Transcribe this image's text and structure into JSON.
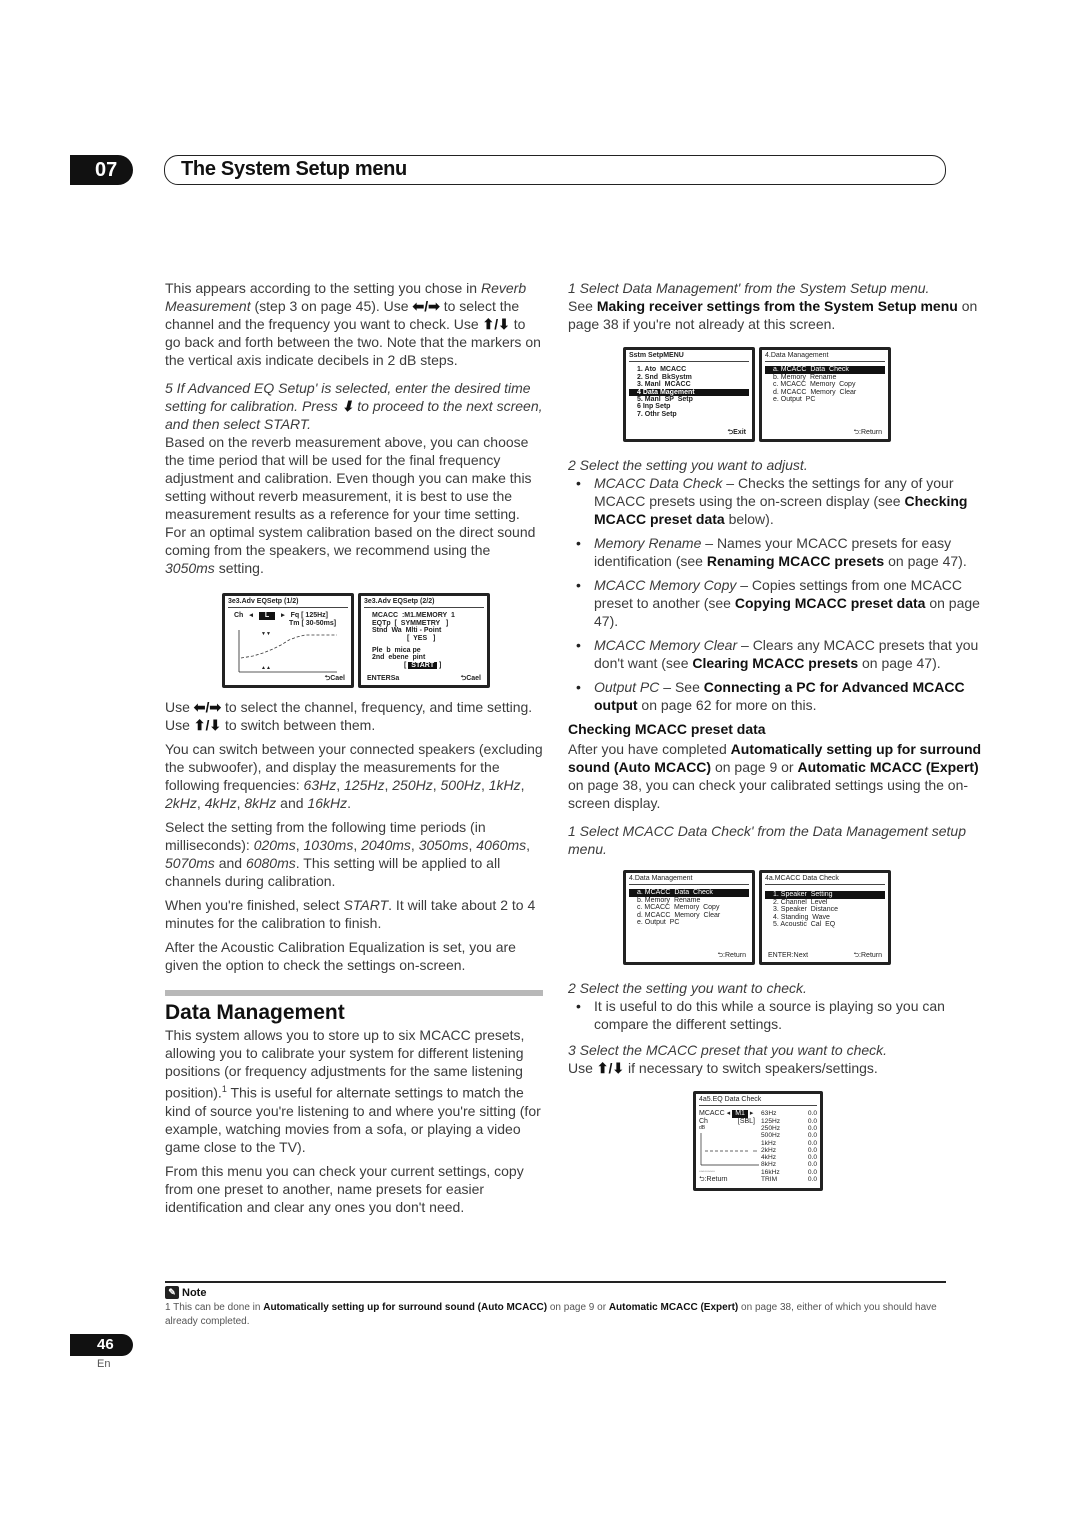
{
  "header": {
    "chapter": "07",
    "title": "The System Setup menu"
  },
  "left": {
    "p1": [
      "This appears according to the setting you chose in ",
      "Reverb Measurement",
      " (step 3 on page 45). Use ",
      "⬅/➡",
      " to select the channel and the frequency you want to check. Use ",
      "⬆/⬇",
      " to go back and forth between the two. Note that the markers on the vertical axis indicate decibels in 2 dB steps."
    ],
    "step5": [
      "5   If ",
      "Advanced EQ Setup",
      "' is selected, enter the desired time setting for calibration. Press ",
      "⬇",
      " to proceed to the next screen, and then select ",
      "START",
      "."
    ],
    "p2": [
      "Based on the reverb measurement above, you can choose the time period that will be used for the final frequency adjustment and calibration. Even though you can make this setting without reverb measurement, it is best to use the measurement results as a reference for your time setting. For an optimal system calibration based on the direct sound coming from the speakers, we recommend using the ",
      "3050ms",
      " setting."
    ],
    "osd1": {
      "title": "3e3.Adv EQSetp    (1/2)",
      "ch_label": "Ch",
      "ch_value": "L",
      "fq": "Fq [   125Hz]",
      "tm": "Tm [ 30-50ms]",
      "cancel": "⮌Cael"
    },
    "osd2": {
      "title": "3e3.Adv EQSetp    (2/2)",
      "rows": [
        "MCACC  :M1.MEMORY  1",
        "EQTp  [  SYMMETRY   ]",
        "Stnd  Wa  Mlti - Point",
        "                  [  YES   ]",
        "",
        "Ple  b  mica pe",
        "2nd  ebene  pint"
      ],
      "start": "START",
      "enter": "ENTERSa",
      "cancel": "⮌Cael"
    },
    "p3": [
      "Use ",
      "⬅/➡",
      " to select the channel, frequency, and time setting. Use ",
      "⬆/⬇",
      " to switch between them."
    ],
    "p4": [
      "You can switch between your connected speakers (excluding the subwoofer), and display the measurements for the following frequencies: ",
      "63Hz",
      ", ",
      "125Hz",
      ", ",
      "250Hz",
      ", ",
      "500Hz",
      ", ",
      "1kHz",
      ", ",
      "2kHz",
      ", ",
      "4kHz",
      ", ",
      "8kHz",
      " and ",
      "16kHz",
      "."
    ],
    "p5": [
      "Select the setting from the following time periods (in milliseconds): ",
      "020ms",
      ", ",
      "1030ms",
      ", ",
      "2040ms",
      ", ",
      "3050ms",
      ", ",
      "4060ms",
      ", ",
      "5070ms",
      " and ",
      "6080ms",
      ". This setting will be applied to all channels during calibration."
    ],
    "p6": [
      "When you're finished, select ",
      "START",
      ". It will take about 2 to 4 minutes for the calibration to finish."
    ],
    "p7": "After the Acoustic Calibration Equalization is set, you are given the option to check the settings on-screen.",
    "section_title": "Data Management",
    "p8": [
      "This system allows you to store up to six MCACC presets, allowing you to calibrate your system for different listening positions (or frequency adjustments for the same listening position).",
      "1",
      " This is useful for alternate settings to match the kind of source you're listening to and where you're sitting (for example, watching movies from a sofa, or playing a video game close to the TV)."
    ],
    "p9": "From this menu you can check your current settings, copy from one preset to another, name presets for easier identification and clear any ones you don't need."
  },
  "right": {
    "step1": [
      "1   Select ",
      "Data Management",
      "' from the System Setup menu."
    ],
    "p1": [
      "See ",
      "Making receiver settings from the System Setup menu",
      " on page 38 if you're not already at this screen."
    ],
    "osd_menu": {
      "title": "Sstm  SetpMENU",
      "items": [
        "1. Ato  MCACC",
        "2. Snd  BkSystm",
        "3. Manl  MCACC",
        "4 Data Magement",
        "5. Manl  SP  Setp",
        "6 Inp Setp",
        "7. Othr Setp"
      ],
      "selected": 3,
      "exit": "⮌Exit"
    },
    "osd_dm": {
      "title": "4.Data  Management",
      "items": [
        "a. MCACC  Data  Check",
        "b. Memory  Rename",
        "c. MCACC  Memory  Copy",
        "d. MCACC  Memory  Clear",
        "e. Output  PC"
      ],
      "selected": 0,
      "return": "⮌:Return"
    },
    "step2": "2   Select the setting you want to adjust.",
    "bullets": [
      {
        "term": "MCACC Data Check",
        "text": " – Checks the settings for any of your MCACC presets using the on-screen display (see ",
        "link": "Checking MCACC preset data",
        "after": " below)."
      },
      {
        "term": "Memory Rename",
        "text": " – Names your MCACC presets for easy identification (see ",
        "link": "Renaming MCACC presets",
        "after": " on page 47)."
      },
      {
        "term": "MCACC Memory Copy",
        "text": " – Copies settings from one MCACC preset to another (see ",
        "link": "Copying MCACC preset data",
        "after": " on page 47)."
      },
      {
        "term": "MCACC Memory Clear",
        "text": " – Clears any MCACC presets that you don't want (see ",
        "link": "Clearing MCACC presets",
        "after": " on page 47)."
      },
      {
        "term": "Output PC",
        "text": " – See ",
        "link": "Connecting a PC for Advanced MCACC output",
        "after": " on page 62 for more on this."
      }
    ],
    "sub_title": "Checking MCACC preset data",
    "p2": [
      "After you have completed ",
      "Automatically setting up for surround sound (Auto MCACC)",
      " on page 9 or ",
      "Automatic MCACC (Expert)",
      " on page 38, you can check your calibrated settings using the on-screen display."
    ],
    "step1b": [
      "1   Select ",
      "MCACC Data Check",
      "' from the Data Management setup menu."
    ],
    "osd_dm2": {
      "title": "4.Data  Management",
      "items": [
        "a. MCACC  Data  Check",
        "b. Memory  Rename",
        "c. MCACC  Memory  Copy",
        "d. MCACC  Memory  Clear",
        "e. Output  PC"
      ],
      "selected": 0,
      "return": "⮌:Return"
    },
    "osd_check": {
      "title": "4a.MCACC  Data  Check",
      "items": [
        "1. Speaker  Setting",
        "2. Channel  Level",
        "3. Speaker  Distance",
        "4. Standing  Wave",
        "5. Acoustic  Cal  EQ"
      ],
      "selected": 0,
      "next": "ENTER:Next",
      "return": "⮌:Return"
    },
    "step2b": "2   Select the setting you want to check.",
    "bullet2": "It is useful to do this while a source is playing so you can compare the different settings.",
    "step3": [
      "3   Select the ",
      "MCACC preset",
      " that you want to check."
    ],
    "p3": [
      "Use ",
      "⬆/⬇",
      " if necessary to switch speakers/settings."
    ],
    "osd_eq": {
      "title": "4a5.EQ  Data  Check",
      "mcacc_label": "MCACC",
      "mcacc_value": "M1",
      "ch_label": "Ch",
      "ch_value": "[SBL]",
      "db_label": "dB",
      "rows": [
        [
          "63Hz",
          "0.0"
        ],
        [
          "125Hz",
          "0.0"
        ],
        [
          "250Hz",
          "0.0"
        ],
        [
          "500Hz",
          "0.0"
        ],
        [
          "1kHz",
          "0.0"
        ],
        [
          "2kHz",
          "0.0"
        ],
        [
          "4kHz",
          "0.0"
        ],
        [
          "8kHz",
          "0.0"
        ],
        [
          "16kHz",
          "0.0"
        ],
        [
          "TRIM",
          "0.0"
        ]
      ],
      "return": "⮌:Return"
    }
  },
  "note": {
    "title": "Note",
    "text": [
      "1 This can be done in ",
      "Automatically setting up for surround sound (Auto MCACC)",
      " on page 9 or ",
      "Automatic MCACC (Expert)",
      " on page 38, either of which you should have already completed."
    ]
  },
  "footer": {
    "page": "46",
    "lang": "En"
  }
}
